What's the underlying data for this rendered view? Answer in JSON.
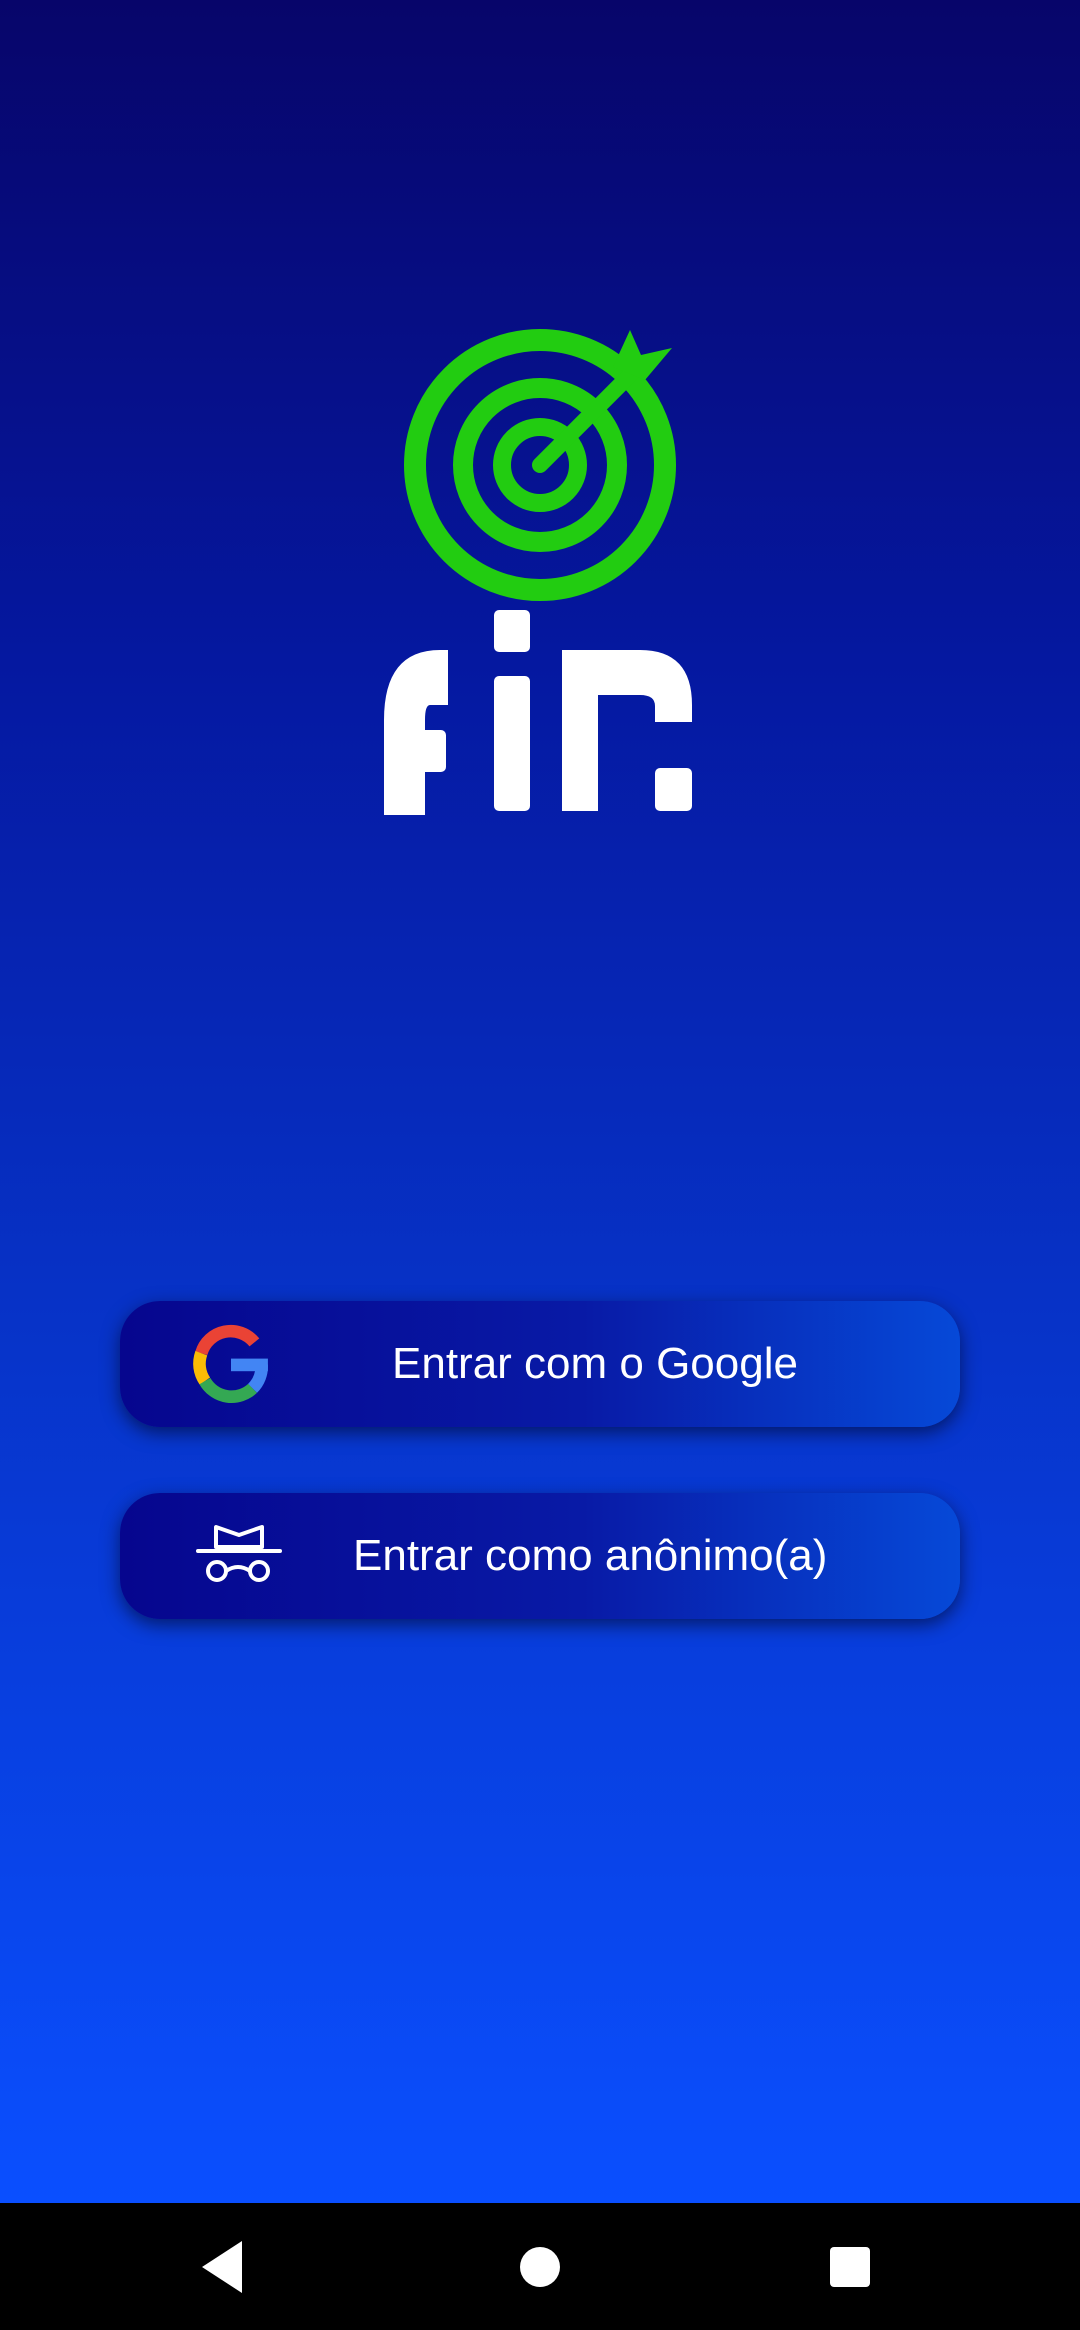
{
  "app": {
    "brand_text": "fin",
    "logo_icon": "target-arrow-icon"
  },
  "login": {
    "google_label": "Entrar com o Google",
    "anonymous_label": "Entrar como anônimo(a)",
    "google_icon": "google-g-icon",
    "anonymous_icon": "incognito-icon"
  },
  "navigation": {
    "back_icon": "back-triangle-icon",
    "home_icon": "home-circle-icon",
    "recents_icon": "recents-square-icon"
  },
  "colors": {
    "background_top": "#07056a",
    "background_bottom": "#0a4fff",
    "logo_green": "#22cc11",
    "text": "#ffffff"
  }
}
